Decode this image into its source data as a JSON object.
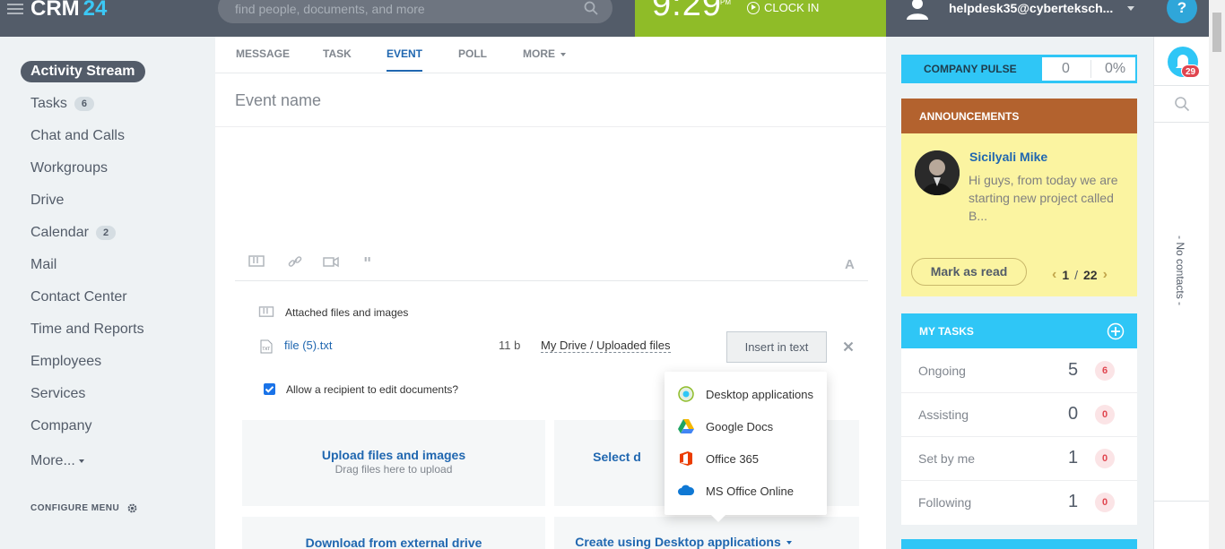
{
  "header": {
    "logo_text": "CRM",
    "logo_num": "24",
    "search_placeholder": "find people, documents, and more",
    "clock_time": "9:29",
    "clock_ampm": "PM",
    "clock_in_label": "CLOCK IN",
    "user_name": "helpdesk35@cyberteksch...",
    "help_label": "?"
  },
  "sidebar": {
    "items": [
      {
        "label": "Activity Stream",
        "badge": ""
      },
      {
        "label": "Tasks",
        "badge": "6"
      },
      {
        "label": "Chat and Calls",
        "badge": ""
      },
      {
        "label": "Workgroups",
        "badge": ""
      },
      {
        "label": "Drive",
        "badge": ""
      },
      {
        "label": "Calendar",
        "badge": "2"
      },
      {
        "label": "Mail",
        "badge": ""
      },
      {
        "label": "Contact Center",
        "badge": ""
      },
      {
        "label": "Time and Reports",
        "badge": ""
      },
      {
        "label": "Employees",
        "badge": ""
      },
      {
        "label": "Services",
        "badge": ""
      },
      {
        "label": "Company",
        "badge": ""
      },
      {
        "label": "More...",
        "badge": ""
      }
    ],
    "configure_label": "CONFIGURE MENU"
  },
  "composer": {
    "tabs": [
      {
        "label": "MESSAGE"
      },
      {
        "label": "TASK"
      },
      {
        "label": "EVENT"
      },
      {
        "label": "POLL"
      },
      {
        "label": "MORE"
      }
    ],
    "event_name_placeholder": "Event name",
    "font_button": "A",
    "attached_title": "Attached files and images",
    "file": {
      "name": "file (5).txt",
      "size": "11 b",
      "path": "My Drive / Uploaded files",
      "insert_label": "Insert in text"
    },
    "allow_edit_label": "Allow a recipient to edit documents?",
    "tiles": {
      "upload_title": "Upload files and images",
      "upload_sub": "Drag files here to upload",
      "select_title": "Select d",
      "external_title": "Download from external drive",
      "create_title": "Create using Desktop applications"
    }
  },
  "popup": {
    "items": [
      {
        "label": "Desktop applications",
        "icon": "desktop-app-icon"
      },
      {
        "label": "Google Docs",
        "icon": "google-drive-icon"
      },
      {
        "label": "Office 365",
        "icon": "office-365-icon"
      },
      {
        "label": "MS Office Online",
        "icon": "cloud-icon"
      }
    ]
  },
  "pulse": {
    "label": "COMPANY PULSE",
    "value": "0",
    "percent": "0%"
  },
  "announcements": {
    "title": "ANNOUNCEMENTS",
    "author": "Sicilyali Mike",
    "text": "Hi guys, from today we are starting new project called B...",
    "mark_read_label": "Mark as read",
    "page_current": "1",
    "page_sep": "/",
    "page_total": "22"
  },
  "my_tasks": {
    "title": "MY TASKS",
    "rows": [
      {
        "label": "Ongoing",
        "count": "5",
        "badge": "6"
      },
      {
        "label": "Assisting",
        "count": "0",
        "badge": "0"
      },
      {
        "label": "Set by me",
        "count": "1",
        "badge": "0"
      },
      {
        "label": "Following",
        "count": "1",
        "badge": "0"
      }
    ]
  },
  "right_panel": {
    "notifications_count": "29",
    "no_contacts_label": "- No contacts -"
  },
  "colors": {
    "topbar": "#535c69",
    "accent_blue": "#2fc6f6",
    "clock_green": "#8fbc28",
    "link_blue": "#2067b0",
    "announce_brown": "#b3622e",
    "announce_yellow": "#fbf4a1"
  }
}
